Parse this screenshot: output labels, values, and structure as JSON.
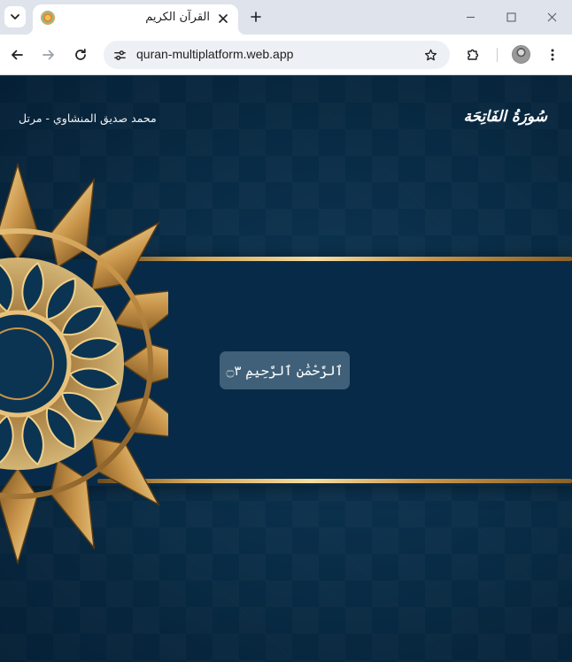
{
  "browser": {
    "tab": {
      "title": "القرآن الكريم",
      "favicon": "quran-app-favicon"
    },
    "url": "quran-multiplatform.web.app",
    "icons": {
      "tab_search": "chevron-down-icon",
      "close_tab": "close-icon",
      "new_tab": "plus-icon",
      "minimize": "minimize-icon",
      "maximize": "maximize-icon",
      "close_window": "close-icon",
      "back": "back-arrow-icon",
      "forward": "forward-arrow-icon",
      "reload": "reload-icon",
      "site_info": "tune-icon",
      "bookmark": "star-icon",
      "extensions": "puzzle-icon",
      "menu": "kebab-menu-icon"
    }
  },
  "app": {
    "reciter": "محمد صديق المنشاوي - مرتل",
    "surah_title": "سُورَةُ الفَاتِحَة",
    "verse": "ٱلرَّحْمَٰنِ ٱلرَّحِيمِ ۝٣",
    "colors": {
      "background": "#0b3452",
      "band": "#072a48",
      "gold": "#d6a85a",
      "verse_card": "#6e8ca0"
    }
  }
}
